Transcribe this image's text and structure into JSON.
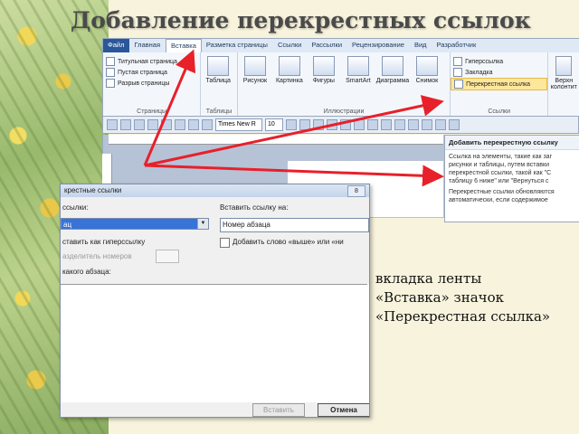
{
  "slide_title": "Добавление перекрестных ссылок",
  "ribbon": {
    "tabs": [
      "Файл",
      "Главная",
      "Вставка",
      "Разметка страницы",
      "Ссылки",
      "Рассылки",
      "Рецензирование",
      "Вид",
      "Разработчик"
    ],
    "active_tab": "Вставка",
    "pages_group": {
      "items": [
        "Титульная страница",
        "Пустая страница",
        "Разрыв страницы"
      ],
      "label": "Страницы"
    },
    "tables_group": {
      "button": "Таблица",
      "label": "Таблицы"
    },
    "illustrations_group": {
      "buttons": [
        "Рисунок",
        "Картинка",
        "Фигуры",
        "SmartArt",
        "Диаграмма",
        "Снимок"
      ],
      "label": "Иллюстрации"
    },
    "links_group": {
      "items": [
        "Гиперссылка",
        "Закладка",
        "Перекрестная ссылка"
      ],
      "label": "Ссылки"
    },
    "header_group": {
      "button": "Верхн колонтит"
    }
  },
  "toolbar": {
    "font": "Times New R",
    "size": "10"
  },
  "tooltip": {
    "title": "Добавить перекрестную ссылку",
    "p1": "Ссылка на элементы, такие как заг рисунки и таблицы, путем вставки перекрестной ссылки, такой как \"С таблицу 6 ниже\" или \"Вернуться с",
    "p2": "Перекрестные ссылки обновляются автоматически, если содержимое"
  },
  "dialog": {
    "title": "крестные ссылки",
    "close_glyph": "8",
    "type_label": "ссылки:",
    "type_value": "ац",
    "insert_label": "Вставить ссылку на:",
    "insert_value": "Номер абзаца",
    "hyperlink_label": "ставить как гиперссылку",
    "above_below_label": "Добавить слово «выше» или «ни",
    "separator_label": "азделитель номеров",
    "which_label": "какого абзаца:",
    "insert_button": "Вставить",
    "cancel_button": "Отмена"
  },
  "caption": {
    "line1": "вкладка ленты",
    "line2": "«Вставка»  значок",
    "line3": "«Перекрестная ссылка»"
  },
  "colors": {
    "arrows": "#e8202a"
  }
}
